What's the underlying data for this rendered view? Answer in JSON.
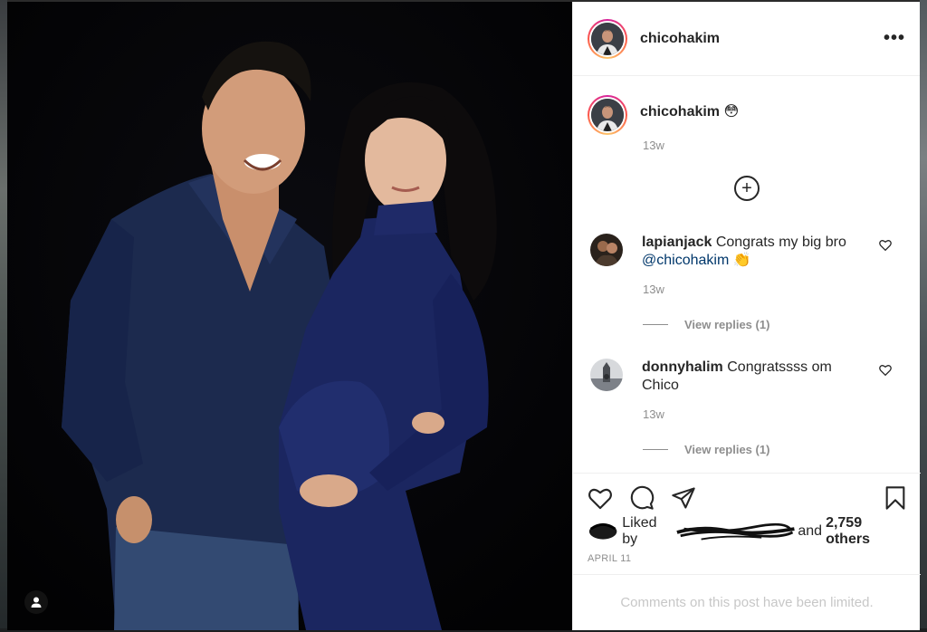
{
  "post": {
    "username": "chicohakim",
    "more_label": "•••"
  },
  "caption": {
    "username": "chicohakim",
    "emoji": "😳",
    "time": "13w"
  },
  "comments": [
    {
      "username": "lapianjack",
      "text": "Congrats my big bro",
      "mention": "@chicohakim",
      "emoji": "👏",
      "time": "13w",
      "replies_label": "View replies (1)"
    },
    {
      "username": "donnyhalim",
      "text": "Congratssss om Chico",
      "time": "13w",
      "replies_label": "View replies (1)"
    }
  ],
  "likes": {
    "prefix": "Liked by",
    "suffix": "and",
    "count_text": "2,759 others"
  },
  "date": "APRIL 11",
  "comment_box": {
    "text": "Comments on this post have been limited."
  },
  "icons": {
    "like": "heart-icon",
    "comment": "comment-bubble-icon",
    "share": "paper-plane-icon",
    "save": "bookmark-icon",
    "load_more": "plus-circle-icon",
    "user_tag": "person-icon"
  },
  "colors": {
    "text": "#262626",
    "secondary": "#8e8e8e",
    "mention": "#00376b",
    "border": "#efefef"
  }
}
